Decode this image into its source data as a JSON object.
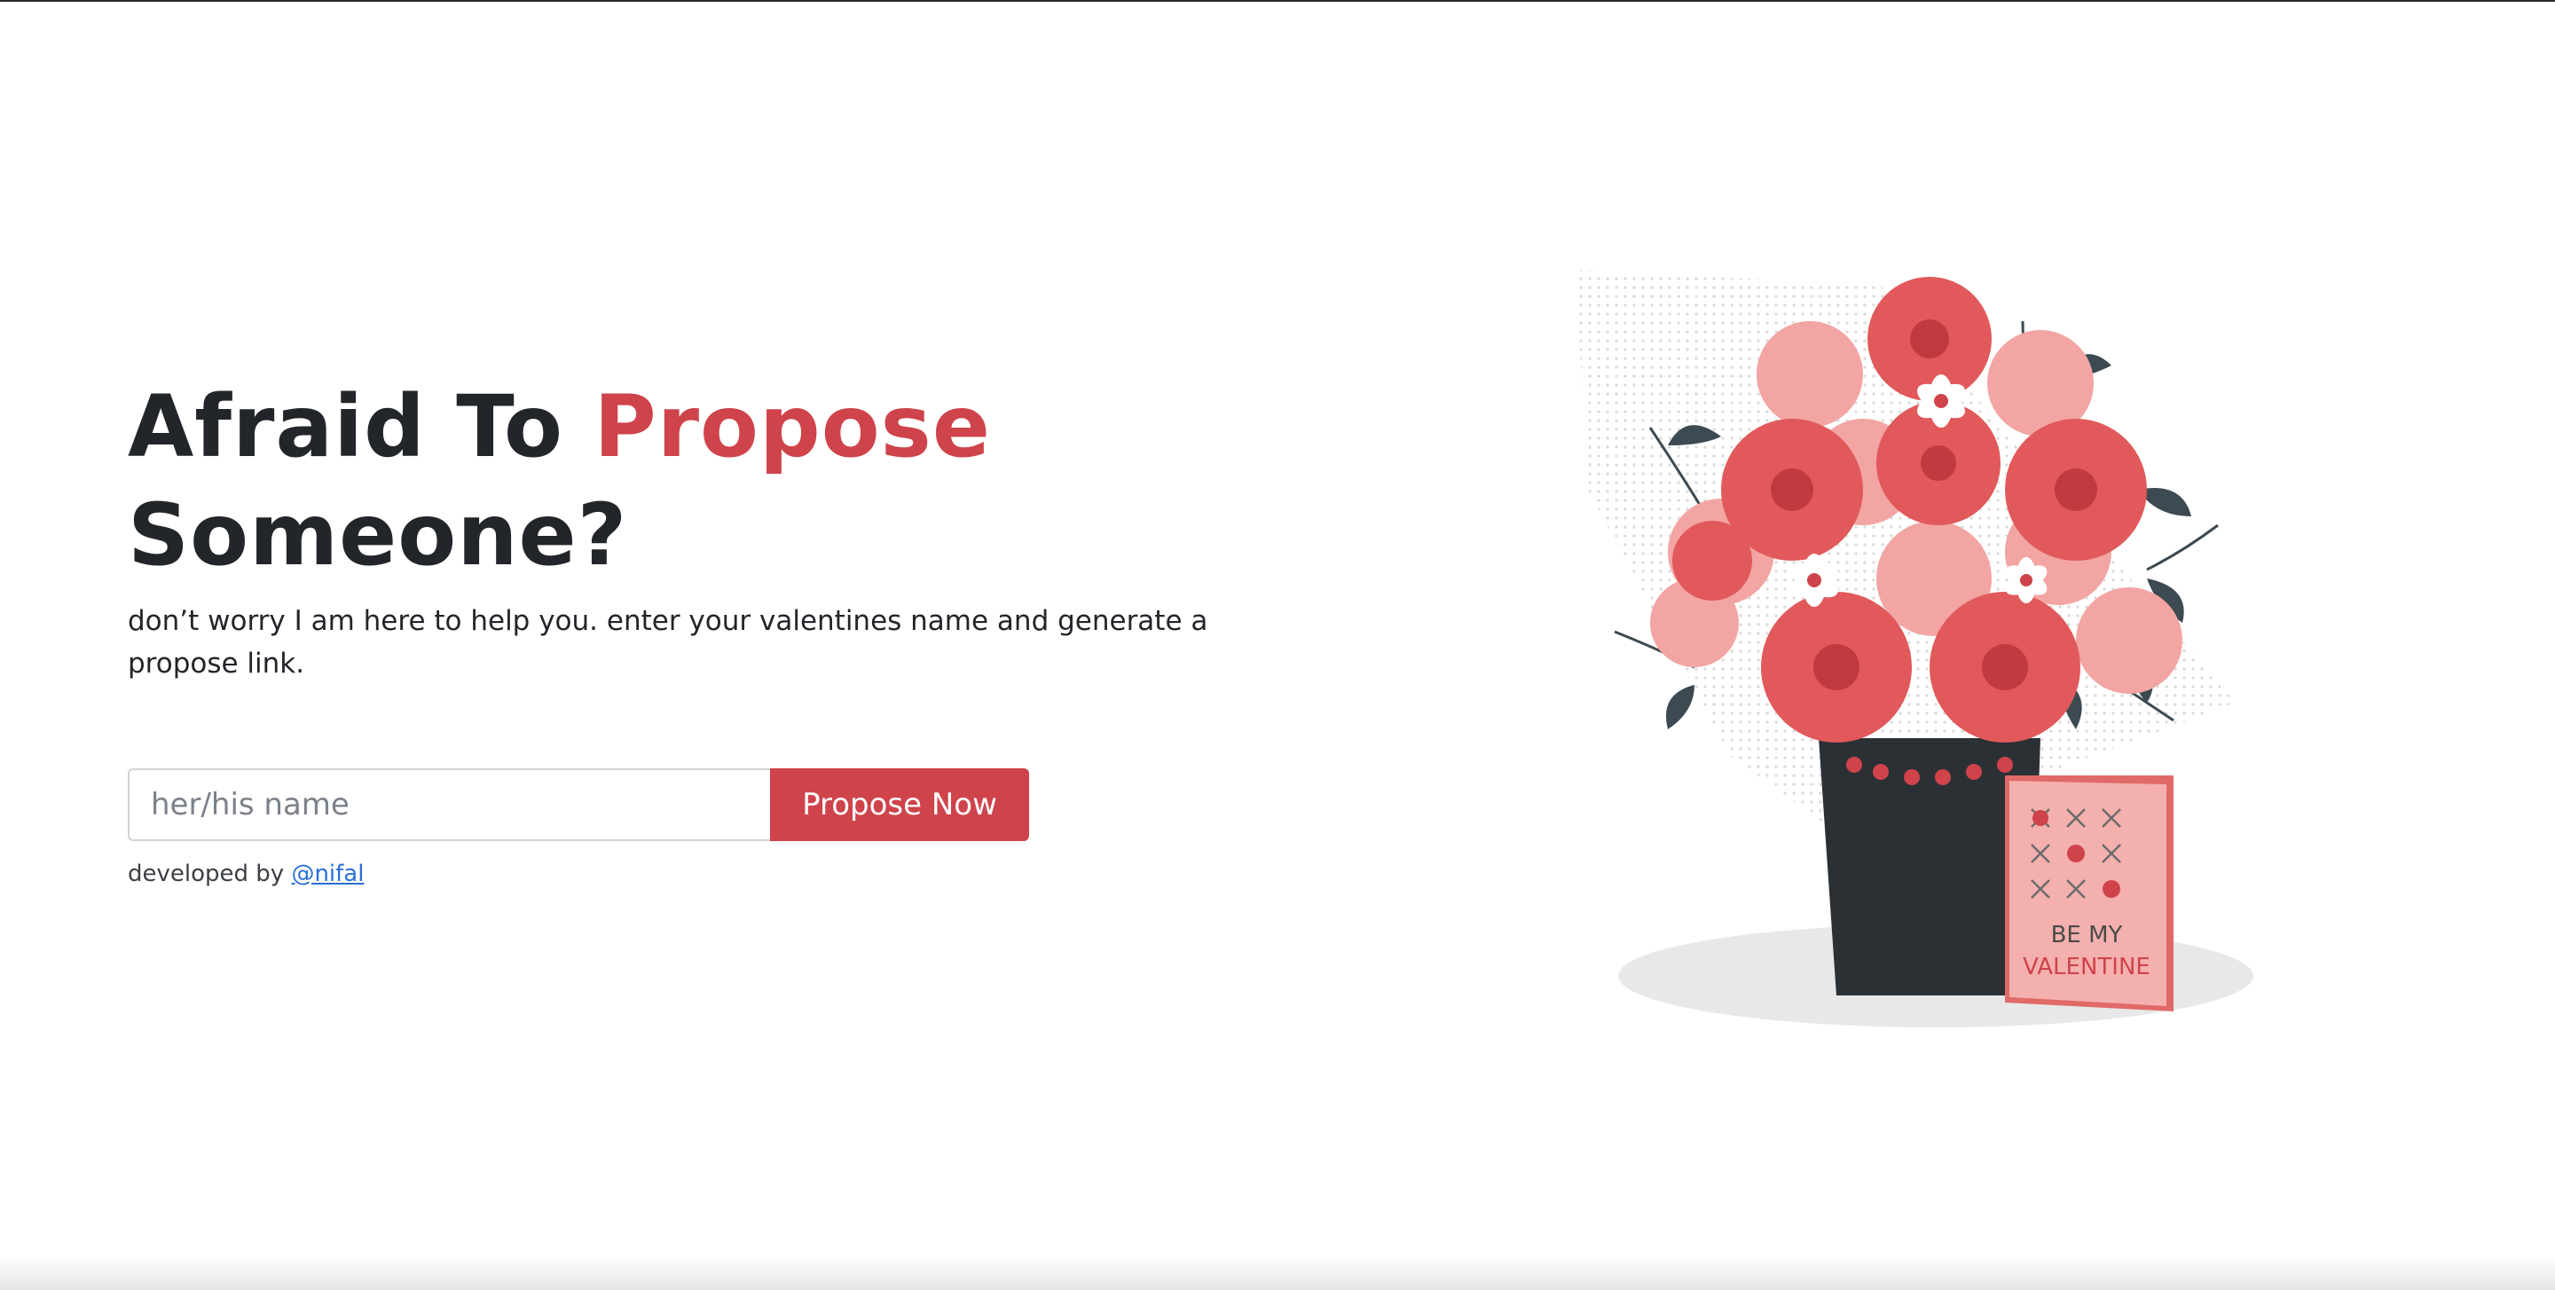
{
  "hero": {
    "title_part1": "Afraid To ",
    "title_accent": "Propose",
    "title_part2": "Someone?",
    "subtitle": "don’t worry I am here to help you. enter your valentines name and generate a propose link."
  },
  "form": {
    "input_placeholder": "her/his name",
    "input_value": "",
    "button_label": "Propose Now"
  },
  "credit": {
    "prefix": "developed by ",
    "link_text": "@nifal"
  },
  "illustration": {
    "card_line1": "BE MY",
    "card_line2": "VALENTINE"
  },
  "colors": {
    "accent": "#cf434b",
    "text": "#222529",
    "link": "#2a6fd6"
  },
  "icons": {
    "illustration": "flower-bouquet-illustration"
  }
}
